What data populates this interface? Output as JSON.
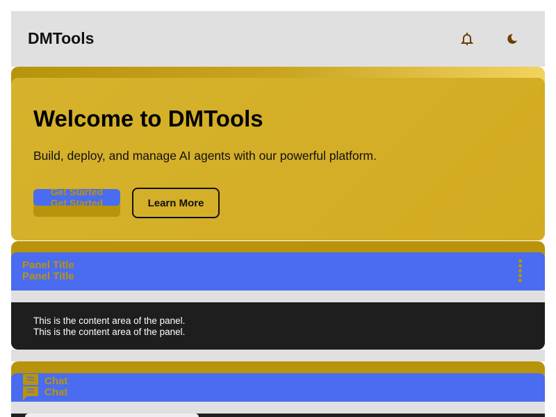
{
  "header": {
    "title": "DMTools",
    "icons": [
      "bell-icon",
      "moon-icon"
    ]
  },
  "hero": {
    "title": "Welcome to DMTools",
    "subtitle": "Build, deploy, and manage AI agents with our powerful platform.",
    "primary_button": "Get Started",
    "secondary_button": "Learn More"
  },
  "panel": {
    "title": "Panel Title",
    "content": "This is the content area of the panel."
  },
  "chat": {
    "title": "Chat"
  },
  "colors": {
    "accent": "#4a6cf0",
    "gold": "#b8940c",
    "dark": "#1e1e1e"
  }
}
